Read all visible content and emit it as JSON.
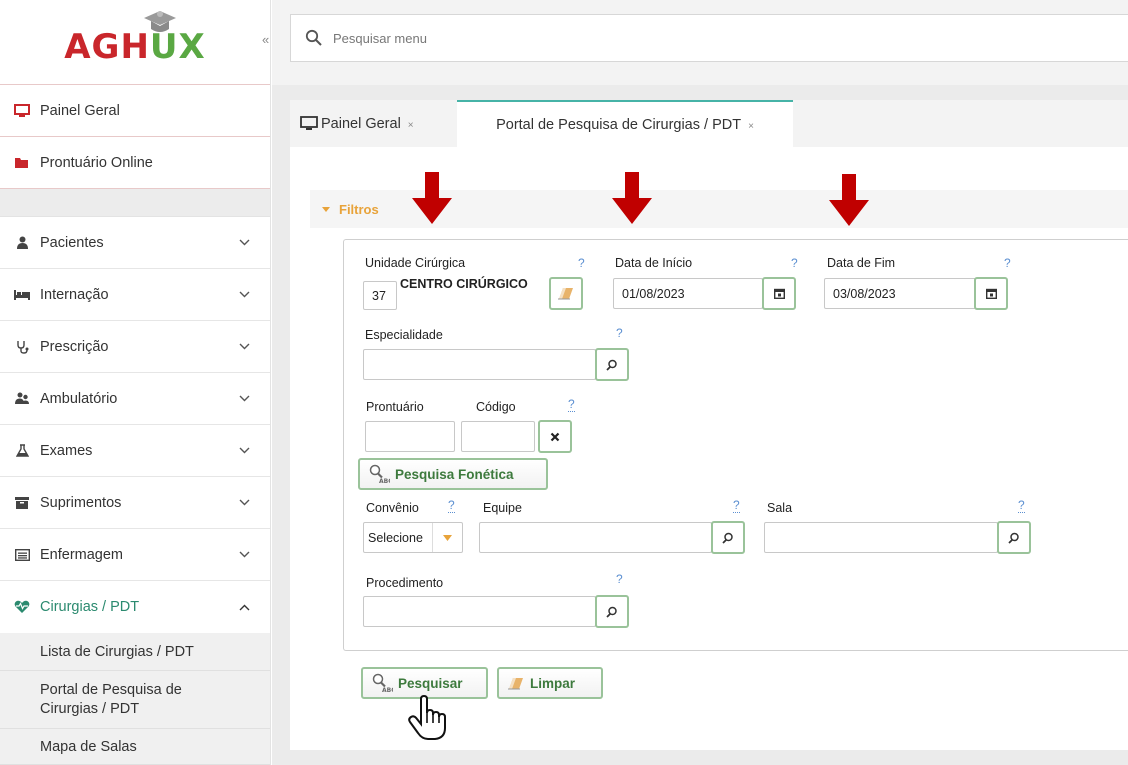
{
  "app": {
    "logo_text_red": "AGH",
    "logo_text_green": "UX",
    "collapse_glyph": "«"
  },
  "search": {
    "placeholder": "Pesquisar menu"
  },
  "sidebar": {
    "top_items": [
      {
        "label": "Painel Geral",
        "icon": "monitor-icon"
      },
      {
        "label": "Prontuário Online",
        "icon": "folder-icon"
      }
    ],
    "items": [
      {
        "label": "Pacientes",
        "icon": "user-icon"
      },
      {
        "label": "Internação",
        "icon": "bed-icon"
      },
      {
        "label": "Prescrição",
        "icon": "stethoscope-icon"
      },
      {
        "label": "Ambulatório",
        "icon": "users-icon"
      },
      {
        "label": "Exames",
        "icon": "flask-icon"
      },
      {
        "label": "Suprimentos",
        "icon": "box-icon"
      },
      {
        "label": "Enfermagem",
        "icon": "list-icon"
      },
      {
        "label": "Cirurgias / PDT",
        "icon": "heartbeat-icon"
      }
    ],
    "sub_items": [
      {
        "label": "Lista de Cirurgias / PDT"
      },
      {
        "label": "Portal de Pesquisa de Cirurgias / PDT"
      },
      {
        "label": "Mapa de Salas"
      }
    ]
  },
  "tabs": [
    {
      "label": "Painel Geral",
      "close": "×"
    },
    {
      "label": "Portal de Pesquisa de Cirurgias / PDT",
      "close": "×"
    }
  ],
  "filters": {
    "title": "Filtros",
    "help": "?",
    "unidade": {
      "label": "Unidade Cirúrgica",
      "code": "37",
      "name": "CENTRO CIRÚRGICO"
    },
    "data_inicio": {
      "label": "Data de Início",
      "value": "01/08/2023"
    },
    "data_fim": {
      "label": "Data de Fim",
      "value": "03/08/2023"
    },
    "especialidade": {
      "label": "Especialidade",
      "value": ""
    },
    "prontuario": {
      "label": "Prontuário",
      "value": ""
    },
    "codigo": {
      "label": "Código",
      "value": ""
    },
    "pesquisa_fonetica": {
      "label": "Pesquisa Fonética"
    },
    "convenio": {
      "label": "Convênio",
      "value": "Selecione"
    },
    "equipe": {
      "label": "Equipe",
      "value": ""
    },
    "sala": {
      "label": "Sala",
      "value": ""
    },
    "procedimento": {
      "label": "Procedimento",
      "value": ""
    }
  },
  "actions": {
    "pesquisar": "Pesquisar",
    "limpar": "Limpar"
  },
  "colors": {
    "accent_teal": "#46b3a7",
    "filter_orange": "#e8a33a",
    "button_green_text": "#3d7a3d",
    "arrow_red": "#c00000",
    "help_blue": "#5b8fd1"
  }
}
